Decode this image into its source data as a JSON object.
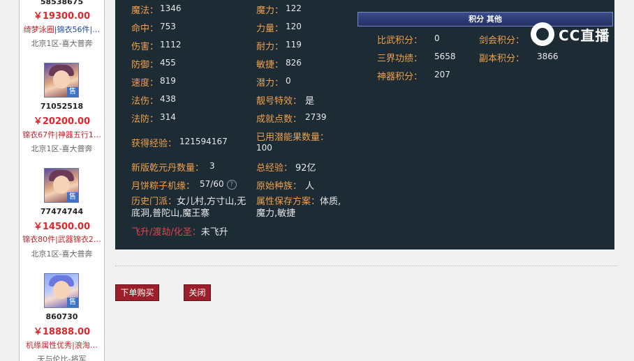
{
  "sidebar": {
    "items": [
      {
        "uid": "58538675",
        "price": "￥19300.00",
        "tags_red": "绮梦泳圈",
        "tags_blue": "|锦衣56件|…",
        "server": "北京1区-喜大普奔"
      },
      {
        "uid": "71052518",
        "price": "￥20200.00",
        "tags_red": "锦衣67件|神器五行1…",
        "tags_blue": "",
        "server": "北京1区-喜大普奔",
        "avatar_badge": "售"
      },
      {
        "uid": "77474744",
        "price": "￥14500.00",
        "tags_red": "锦衣80件|武器锦衣2…",
        "tags_blue": "",
        "server": "北京1区-喜大普奔",
        "avatar_badge": "售"
      },
      {
        "uid": "860730",
        "price": "￥18888.00",
        "tags_red": "",
        "tags_blue": "机缘属性优秀|浪淘…",
        "server": "天与伦比-将军",
        "avatar_badge": "售"
      }
    ]
  },
  "stats": {
    "mofa_label": "魔法：",
    "mofa": "1346",
    "moli_label": "魔力：",
    "moli": "122",
    "mingzhong_label": "命中：",
    "mingzhong": "753",
    "liliang_label": "力量：",
    "liliang": "120",
    "shanghai_label": "伤害：",
    "shanghai": "1112",
    "naili_label": "耐力：",
    "naili": "119",
    "fangyu_label": "防御：",
    "fangyu": "455",
    "minjie_label": "敏捷：",
    "minjie": "826",
    "sudu_label": "速度：",
    "sudu": "819",
    "qianli_label": "潜力：",
    "qianli": "0",
    "fashang_label": "法伤：",
    "fashang": "438",
    "lianghao_label": "靓号特效：",
    "lianghao": "是",
    "fafang_label": "法防：",
    "fafang": "314",
    "chengjiu_label": "成就点数：",
    "chengjiu": "2739",
    "jingyan_label": "获得经验：",
    "jingyan": "121594167",
    "qiannengguo_label": "已用潜能果数量：",
    "qiannengguo": "100",
    "qianyuandan_label": "新版乾元丹数量：",
    "qianyuandan": "3",
    "zongjingyan_label": "总经验：",
    "zongjingyan": "92亿",
    "yuebing_label": "月饼粽子机缘：",
    "yuebing": "57/60",
    "yuanshi_label": "原始种族：",
    "yuanshi": "人",
    "lishi_label": "历史门派：",
    "lishi": "女儿村,方寸山,无底洞,普陀山,魔王寨",
    "baocun_label": "属性保存方案：",
    "baocun": "体质,魔力,敏捷",
    "feisheng_label": "飞升/渡劫/化圣：",
    "feisheng": "未飞升"
  },
  "other": {
    "header": "积分 其他",
    "biwu_label": "比武积分：",
    "biwu": "0",
    "jianhui_label": "剑会积分：",
    "jianhui": "",
    "sanjie_label": "三界功绩：",
    "sanjie": "5658",
    "fuben_label": "副本积分：",
    "fuben": "3866",
    "shenqi_label": "神器积分：",
    "shenqi": "207"
  },
  "watermark": {
    "text": "CC直播"
  },
  "actions": {
    "buy_label": "下单购买",
    "close_label": "关闭"
  },
  "colors": {
    "panel_bg": "#1d2b35",
    "label_orange": "#f0a14a",
    "button_red": "#9a1f2a",
    "price_red": "#e0262c"
  }
}
